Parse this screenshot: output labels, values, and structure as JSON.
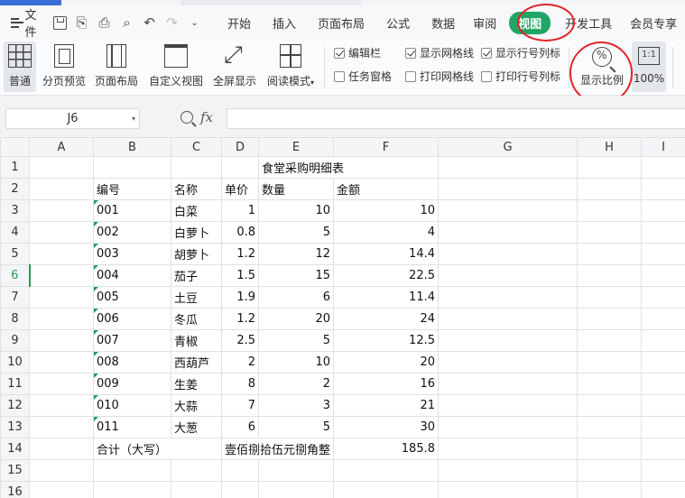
{
  "menubar": {
    "file_label": "文件",
    "tabs": [
      "开始",
      "插入",
      "页面布局",
      "公式",
      "数据",
      "审阅",
      "视图",
      "开发工具",
      "会员专享"
    ],
    "active_tab": "视图"
  },
  "ribbon": {
    "buttons": {
      "normal": "普通",
      "page_break": "分页预览",
      "page_layout": "页面布局",
      "custom_view": "自定义视图",
      "full_screen": "全屏显示",
      "reading_mode": "阅读模式",
      "zoom": "显示比例",
      "zoom_100": "100%",
      "zoom_100_icon": "1:1"
    },
    "checks": {
      "formula_bar": {
        "label": "编辑栏",
        "checked": true
      },
      "task_pane": {
        "label": "任务窗格",
        "checked": false
      },
      "show_gridlines": {
        "label": "显示网格线",
        "checked": true
      },
      "print_gridlines": {
        "label": "打印网格线",
        "checked": false
      },
      "show_headings": {
        "label": "显示行号列标",
        "checked": true
      },
      "print_headings": {
        "label": "打印行号列标",
        "checked": false
      }
    }
  },
  "formula": {
    "cell_ref": "J6",
    "fx_label": "fx",
    "value": ""
  },
  "sheet": {
    "columns": [
      "A",
      "B",
      "C",
      "D",
      "E",
      "F",
      "G",
      "H",
      "I"
    ],
    "rows": [
      "1",
      "2",
      "3",
      "4",
      "5",
      "6",
      "7",
      "8",
      "9",
      "10",
      "11",
      "12",
      "13",
      "14",
      "15",
      "16"
    ],
    "title": "食堂采购明细表",
    "headers": {
      "b": "编号",
      "c": "名称",
      "d": "单价",
      "e": "数量",
      "f": "金额"
    },
    "data": [
      {
        "b": "001",
        "c": "白菜",
        "d": "1",
        "e": "10",
        "f": "10"
      },
      {
        "b": "002",
        "c": "白萝卜",
        "d": "0.8",
        "e": "5",
        "f": "4"
      },
      {
        "b": "003",
        "c": "胡萝卜",
        "d": "1.2",
        "e": "12",
        "f": "14.4"
      },
      {
        "b": "004",
        "c": "茄子",
        "d": "1.5",
        "e": "15",
        "f": "22.5"
      },
      {
        "b": "005",
        "c": "土豆",
        "d": "1.9",
        "e": "6",
        "f": "11.4"
      },
      {
        "b": "006",
        "c": "冬瓜",
        "d": "1.2",
        "e": "20",
        "f": "24"
      },
      {
        "b": "007",
        "c": "青椒",
        "d": "2.5",
        "e": "5",
        "f": "12.5"
      },
      {
        "b": "008",
        "c": "西葫芦",
        "d": "2",
        "e": "10",
        "f": "20"
      },
      {
        "b": "009",
        "c": "生姜",
        "d": "8",
        "e": "2",
        "f": "16"
      },
      {
        "b": "010",
        "c": "大蒜",
        "d": "7",
        "e": "3",
        "f": "21"
      },
      {
        "b": "011",
        "c": "大葱",
        "d": "6",
        "e": "5",
        "f": "30"
      }
    ],
    "total": {
      "label": "合计（大写）",
      "uppercase": "壹佰捌拾伍元捌角整",
      "amount": "185.8"
    },
    "active_row": "6"
  },
  "colors": {
    "accent_green": "#22a565",
    "annotation_red": "#e0242a"
  }
}
